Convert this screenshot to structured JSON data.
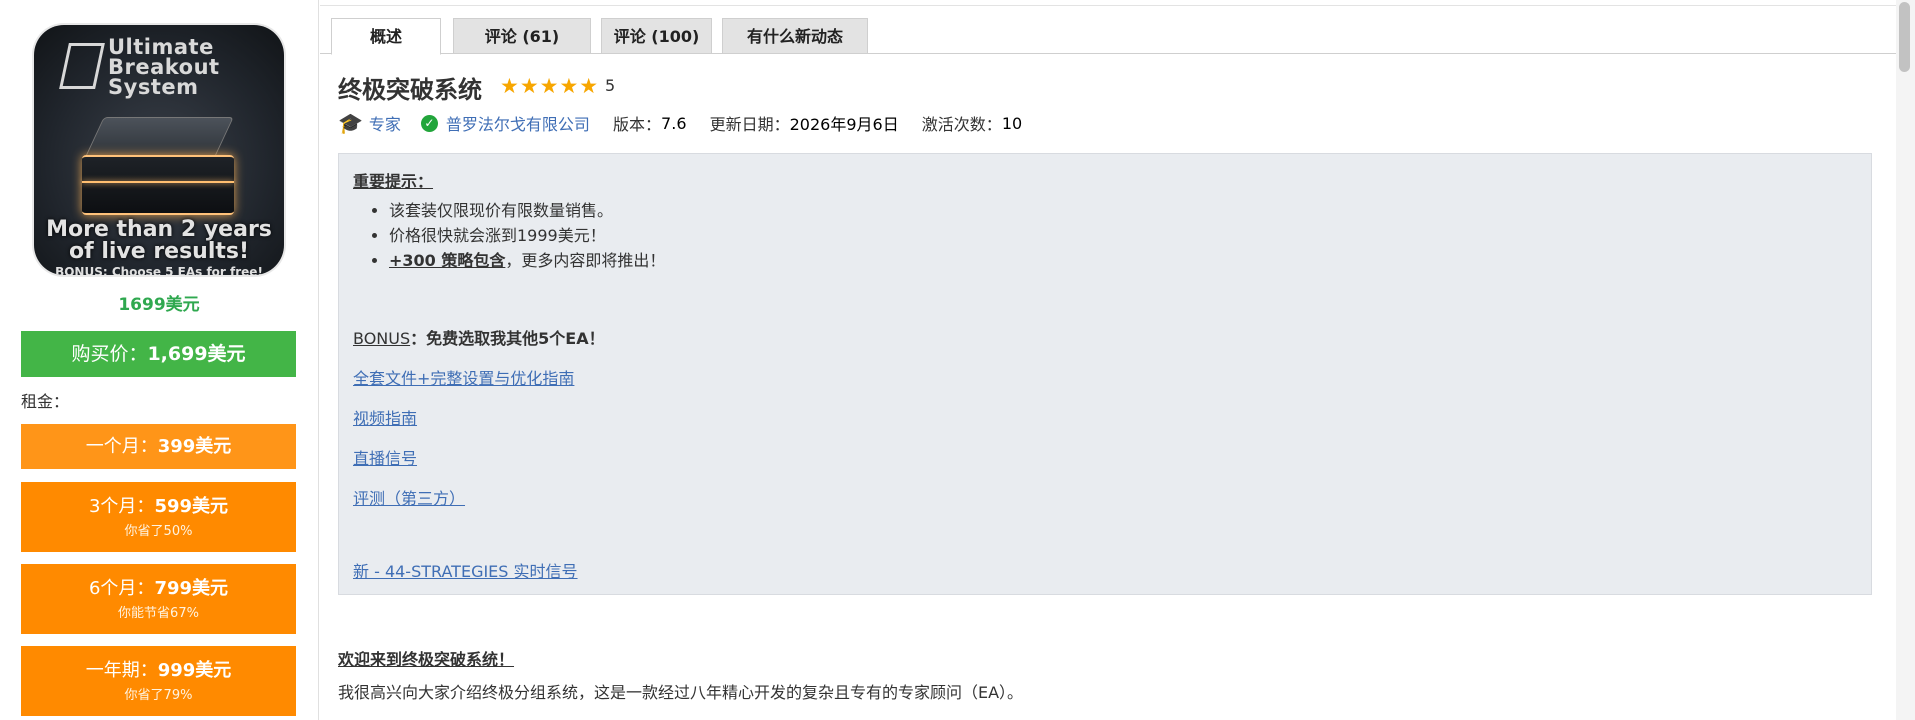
{
  "product": {
    "image": {
      "title": "Ultimate Breakout System",
      "tagline": "More than 2 years of live results!",
      "bonus": "BONUS: Choose 5 EAs for free!"
    },
    "price": "1699美元",
    "buy_label_prefix": "购买价：",
    "buy_price": "1,699美元",
    "rent_label": "租金：",
    "rent_options": [
      {
        "period": "一个月：",
        "price": "399美元",
        "note": ""
      },
      {
        "period": "3个月：",
        "price": "599美元",
        "note": "你省了50%"
      },
      {
        "period": "6个月：",
        "price": "799美元",
        "note": "你能节省67%"
      },
      {
        "period": "一年期：",
        "price": "999美元",
        "note": "你省了79%"
      }
    ]
  },
  "tabs": [
    {
      "label": "概述",
      "active": true
    },
    {
      "label": "评论 (61)",
      "active": false
    },
    {
      "label": "评论 (100)",
      "active": false
    },
    {
      "label": "有什么新动态",
      "active": false
    }
  ],
  "header": {
    "title": "终极突破系统",
    "stars": "★★★★★",
    "rating": "5",
    "category": "专家",
    "author": "普罗法尔戈有限公司",
    "version_label": "版本：",
    "version": "7.6",
    "updated_label": "更新日期：",
    "updated": "2026年9月6日",
    "activations_label": "激活次数：",
    "activations": "10"
  },
  "notice": {
    "heading": "重要提示：",
    "bullets": [
      "该套装仅限现价有限数量销售。",
      "价格很快就会涨到1999美元！"
    ],
    "bullet3_bold": "+300 策略包含",
    "bullet3_rest": "，更多内容即将推出！",
    "bonus_label": "BONUS",
    "bonus_text": "：免费选取我其他5个EA！",
    "links": [
      "全套文件+完整设置与优化指南",
      "视频指南",
      "直播信号",
      "评测（第三方）"
    ],
    "new_signal": "新 - 44-STRATEGIES 实时信号"
  },
  "body": {
    "welcome": "欢迎来到终极突破系统！",
    "intro": "我很高兴向大家介绍终极分组系统，这是一款经过八年精心开发的复杂且专有的专家顾问（EA）。"
  },
  "colors": {
    "buy": "#43b547",
    "rent": "#ff8a00",
    "price": "#2fa84f",
    "link": "#3f6eb5",
    "stars": "#f7a600"
  }
}
